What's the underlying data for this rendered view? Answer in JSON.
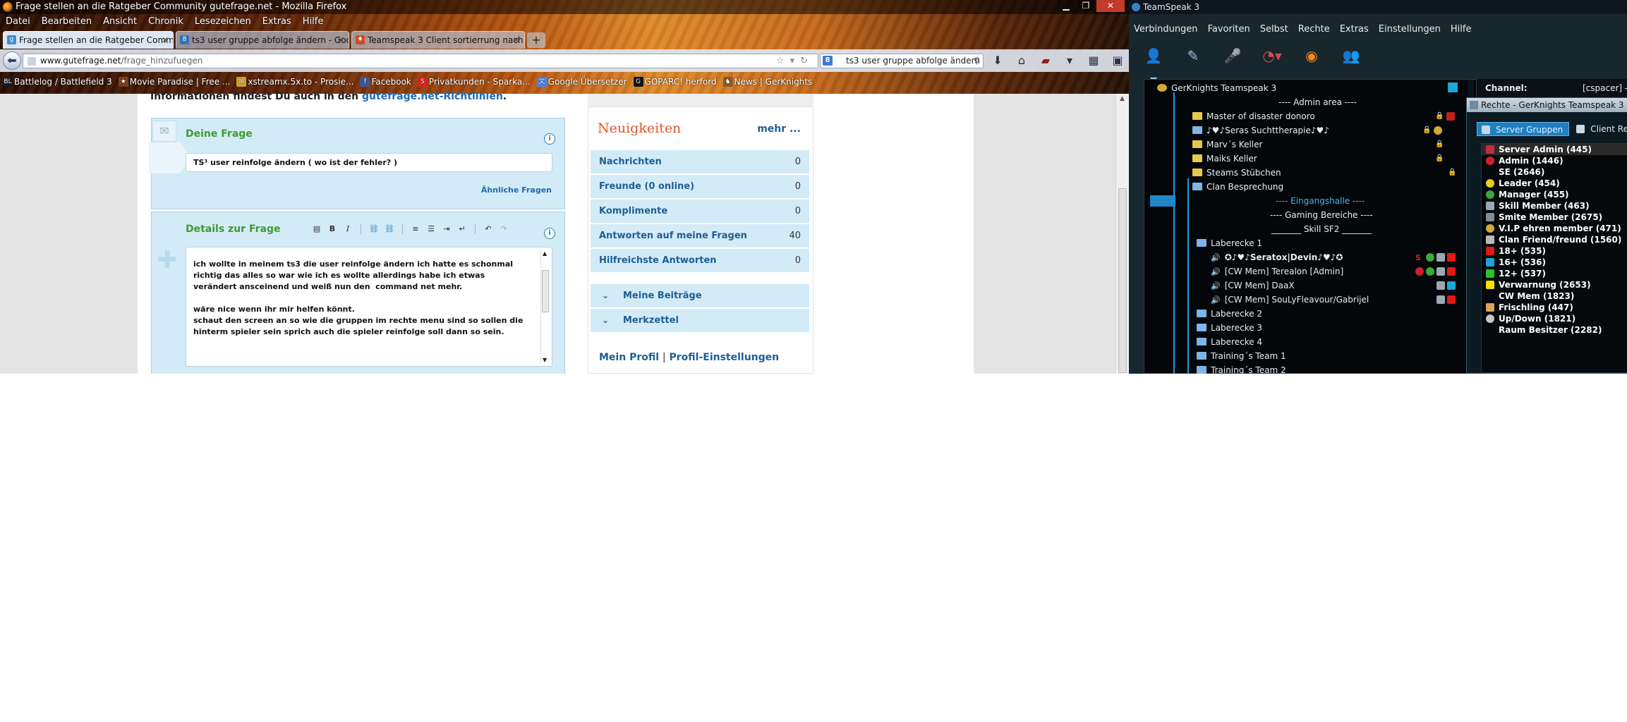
{
  "firefox": {
    "title": "Frage stellen an die Ratgeber Community gutefrage.net - Mozilla Firefox",
    "menu": [
      "Datei",
      "Bearbeiten",
      "Ansicht",
      "Chronik",
      "Lesezeichen",
      "Extras",
      "Hilfe"
    ],
    "tabs": [
      "Frage stellen an die Ratgeber Commu...",
      "ts3 user gruppe abfolge ändern - Goo...",
      "Teamspeak 3 Client sortierrung nach ..."
    ],
    "url_domain": "www.gutefrage.net",
    "url_path": "/frage_hinzufuegen",
    "search_value": "ts3 user gruppe abfolge ändern",
    "bookmarks": [
      {
        "label": "Battlelog / Battlefield 3",
        "color": "#1a1a1a"
      },
      {
        "label": "Movie Paradise | Free ...",
        "color": "#7a3f1a"
      },
      {
        "label": "xstreamx.5x.to - Prosie...",
        "color": "#d2a027"
      },
      {
        "label": "Facebook",
        "color": "#3b5998"
      },
      {
        "label": "Privatkunden - Sparka...",
        "color": "#d8241c"
      },
      {
        "label": "Google Übersetzer",
        "color": "#4285f4"
      },
      {
        "label": "GOPARC! herford",
        "color": "#111111"
      },
      {
        "label": "News | GerKnights",
        "color": "#8a5a2a"
      }
    ]
  },
  "page": {
    "info_prefix": "Informationen findest Du auch in den ",
    "info_link": "gutefrage.net-Richtlinien",
    "info_suffix": ".",
    "question": {
      "heading": "Deine Frage",
      "title_value": "TS³ user reinfolge ändern ( wo ist der fehler? )",
      "similar_link": "Ähnliche Fragen"
    },
    "details": {
      "heading": "Details zur Frage",
      "text": "ich wollte in meinem ts3 die user reinfolge ändern ich hatte es schonmal richtig das alles so war wie ich es wollte allerdings habe ich etwas verändert ansceinend und weiß nun den  command net mehr.\n\nwäre nice wenn ihr mir helfen könnt.\nschaut den screen an so wie die gruppen im rechte menu sind so sollen die hinterm spieler sein sprich auch die spieler reinfolge soll dann so sein."
    },
    "news": {
      "title": "Neuigkeiten",
      "more": "mehr ...",
      "rows": [
        {
          "label": "Nachrichten",
          "count": "0"
        },
        {
          "label": "Freunde (0 online)",
          "count": "0"
        },
        {
          "label": "Komplimente",
          "count": "0"
        },
        {
          "label": "Antworten auf meine Fragen",
          "count": "40"
        },
        {
          "label": "Hilfreichste Antworten",
          "count": "0"
        }
      ],
      "acc1": "Meine Beiträge",
      "acc2": "Merkzettel",
      "profile": "Mein Profil",
      "sep": "|",
      "settings": "Profil-Einstellungen"
    }
  },
  "teamspeak": {
    "title": "TeamSpeak 3",
    "menu": [
      "Verbindungen",
      "Favoriten",
      "Selbst",
      "Rechte",
      "Extras",
      "Einstellungen",
      "Hilfe"
    ],
    "tree": [
      {
        "label": "GerKnights Teamspeak 3",
        "kind": "server"
      },
      {
        "label": "---- Admin area ----",
        "kind": "spacer"
      },
      {
        "label": "Master of disaster donoro",
        "kind": "folder"
      },
      {
        "label": "♪♥♪Seras Suchttherapie♪♥♪",
        "kind": "folder"
      },
      {
        "label": "Marv´s Keller",
        "kind": "folder"
      },
      {
        "label": "Maiks Keller",
        "kind": "folder"
      },
      {
        "label": "Steams Stübchen",
        "kind": "folder"
      },
      {
        "label": "Clan Besprechung",
        "kind": "folder"
      },
      {
        "label": "---- Eingangshalle ----",
        "kind": "spacer-blue"
      },
      {
        "label": "---- Gaming Bereiche ----",
        "kind": "spacer"
      },
      {
        "label": "_______ Skill SF2 _______",
        "kind": "spacer"
      },
      {
        "label": "Laberecke 1",
        "kind": "folder-blue"
      },
      {
        "label": "✪♪♥♪Seratox|Devin♪♥♪✪",
        "kind": "user"
      },
      {
        "label": "[CW Mem] Terealon [Admin]",
        "kind": "user"
      },
      {
        "label": "[CW Mem] DaaX",
        "kind": "user"
      },
      {
        "label": "[CW Mem] SouLyFleavour/Gabrijel",
        "kind": "user"
      },
      {
        "label": "Laberecke 2",
        "kind": "folder-blue"
      },
      {
        "label": "Laberecke 3",
        "kind": "folder-blue"
      },
      {
        "label": "Laberecke 4",
        "kind": "folder-blue"
      },
      {
        "label": "Training´s Team 1",
        "kind": "folder-blue"
      },
      {
        "label": "Training´s Team 2",
        "kind": "folder-blue"
      }
    ],
    "channel_label": "Channel:",
    "channel_value": "[cspacer] ---",
    "rechte_title": "Rechte - GerKnights Teamspeak 3",
    "rechte_tabs": [
      "Server Gruppen",
      "Client Rechte"
    ],
    "groups": [
      {
        "label": "Server Admin (445)",
        "color": "#c0303a"
      },
      {
        "label": "Admin (1446)",
        "color": "#d0202a"
      },
      {
        "label": "SE (2646)",
        "color": "#05090c"
      },
      {
        "label": "Leader (454)",
        "color": "#e6d21a"
      },
      {
        "label": "Manager (455)",
        "color": "#3aa83a"
      },
      {
        "label": "Skill Member (463)",
        "color": "#9aa8b4"
      },
      {
        "label": "Smite Member (2675)",
        "color": "#7f8c96"
      },
      {
        "label": "V.I.P ehren member (471)",
        "color": "#d4a83a"
      },
      {
        "label": "Clan Friend/freund (1560)",
        "color": "#b8b8b8"
      },
      {
        "label": "18+ (535)",
        "color": "#e01818"
      },
      {
        "label": "16+ (536)",
        "color": "#1aa6d8"
      },
      {
        "label": "12+ (537)",
        "color": "#28c428"
      },
      {
        "label": "Verwarnung (2653)",
        "color": "#f2e000"
      },
      {
        "label": "CW Mem (1823)",
        "color": "#05090c"
      },
      {
        "label": "Frischling (447)",
        "color": "#e0a05a"
      },
      {
        "label": "Up/Down (1821)",
        "color": "#c6c6c6"
      },
      {
        "label": "Raum Besitzer (2282)",
        "color": "#05090c"
      }
    ]
  }
}
